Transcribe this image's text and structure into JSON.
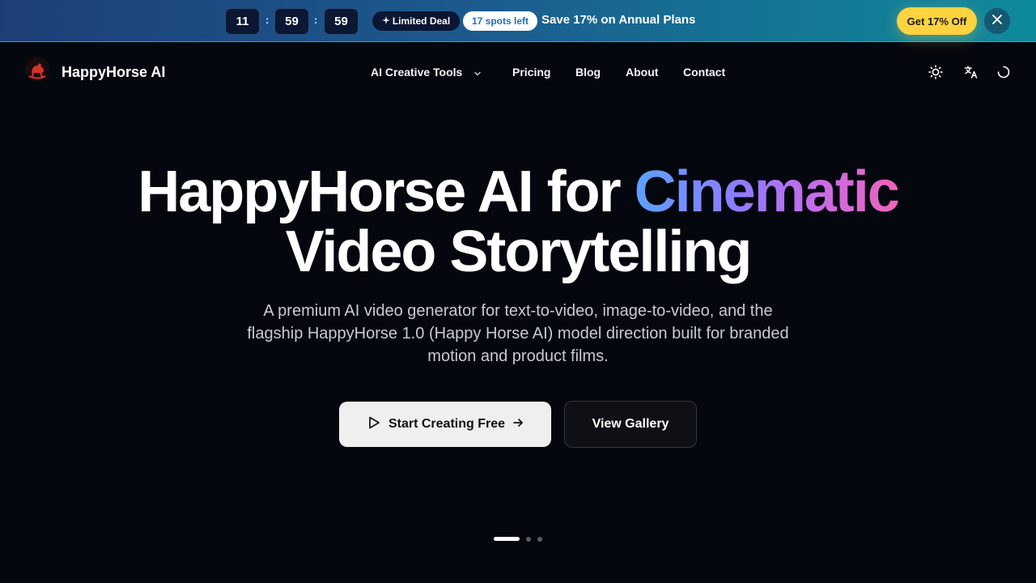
{
  "promo": {
    "timer": {
      "hours": "11",
      "minutes": "59",
      "seconds": "59",
      "separator": ":"
    },
    "deal_label": "Limited Deal",
    "deal_icon": "sparkle-icon",
    "spots_label": "17 spots left",
    "message": "Save 17% on Annual Plans",
    "cta_label": "Get 17% Off",
    "close_icon": "close-icon",
    "colors": {
      "cta": "#ffd23f",
      "banner_start": "#1d3f78",
      "banner_end": "#0f8a9c"
    }
  },
  "nav": {
    "brand": "HappyHorse AI",
    "logo_icon": "rocking-horse-logo",
    "links": [
      {
        "label": "AI Creative Tools",
        "has_dropdown": true
      },
      {
        "label": "Pricing"
      },
      {
        "label": "Blog"
      },
      {
        "label": "About"
      },
      {
        "label": "Contact"
      }
    ],
    "icons": [
      "sun-icon",
      "translate-icon",
      "loading-spinner-icon"
    ]
  },
  "hero": {
    "title_part1": "HappyHorse AI for ",
    "title_highlight": "Cinematic",
    "title_line2": "Video Storytelling",
    "subtitle": "A premium AI video generator for text-to-video, image-to-video, and the flagship HappyHorse 1.0 (Happy Horse AI) model direction built for branded motion and product films.",
    "primary_cta": "Start Creating Free",
    "secondary_cta": "View Gallery",
    "gradient_colors": [
      "#5aa2ff",
      "#8f7bff",
      "#c86ce6",
      "#ef64b8"
    ]
  },
  "carousel": {
    "total_slides": 3,
    "active_slide": 1
  }
}
